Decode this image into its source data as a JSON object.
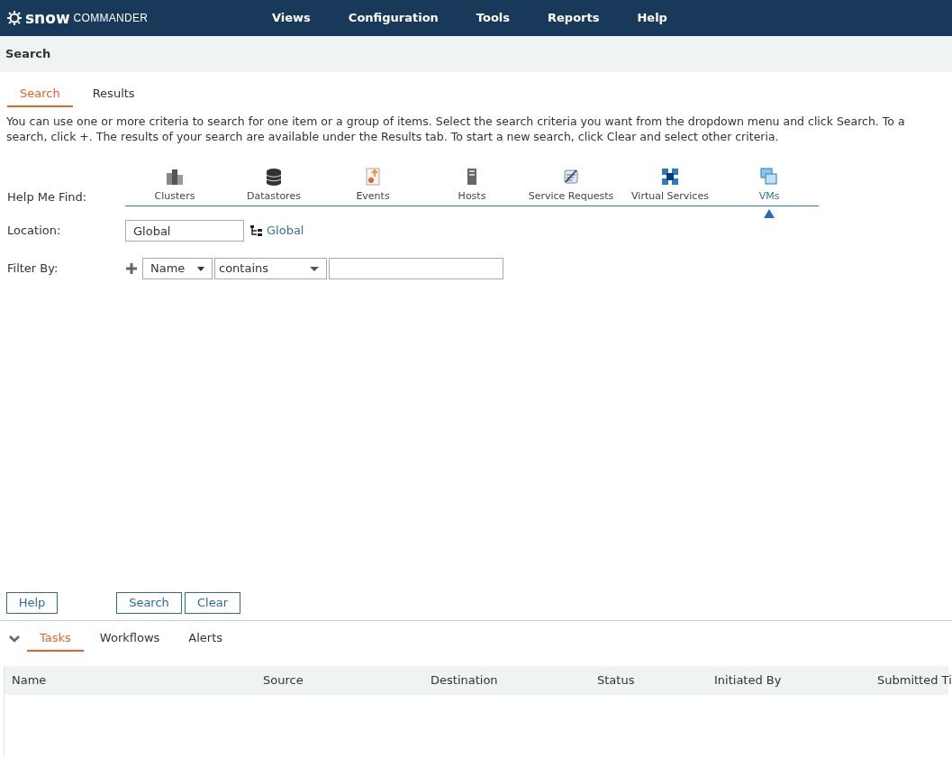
{
  "header": {
    "logo_bold": "snow",
    "logo_light": "COMMANDER",
    "menu": [
      "Views",
      "Configuration",
      "Tools",
      "Reports",
      "Help"
    ]
  },
  "page_title": "Search",
  "tabs": [
    {
      "label": "Search",
      "selected": true
    },
    {
      "label": "Results",
      "selected": false
    }
  ],
  "description": [
    "You can use one or more criteria to search for one item or a group of items. Select the search criteria you want from the dropdown menu and click Search. To a",
    "search, click +. The results of your search are available under the Results tab. To start a new search, click Clear and select other criteria."
  ],
  "help_me_find": {
    "label": "Help Me Find:",
    "items": [
      {
        "label": "Clusters",
        "kind": "clusters",
        "selected": false
      },
      {
        "label": "Datastores",
        "kind": "datastore",
        "selected": false
      },
      {
        "label": "Events",
        "kind": "events",
        "selected": false
      },
      {
        "label": "Hosts",
        "kind": "host",
        "selected": false
      },
      {
        "label": "Service Requests",
        "kind": "request",
        "selected": false
      },
      {
        "label": "Virtual Services",
        "kind": "virtual",
        "selected": false
      },
      {
        "label": "VMs",
        "kind": "vm",
        "selected": true
      }
    ]
  },
  "location": {
    "label": "Location:",
    "value": "Global",
    "link": "Global"
  },
  "filter": {
    "label": "Filter By:",
    "field": "Name",
    "operator": "contains"
  },
  "buttons": {
    "help": "Help",
    "search": "Search",
    "clear": "Clear"
  },
  "bottom_tabs": [
    {
      "label": "Tasks",
      "selected": true
    },
    {
      "label": "Workflows",
      "selected": false
    },
    {
      "label": "Alerts",
      "selected": false
    }
  ],
  "table": {
    "columns": [
      "Name",
      "Source",
      "Destination",
      "Status",
      "Initiated By",
      "Submitted Ti"
    ]
  }
}
